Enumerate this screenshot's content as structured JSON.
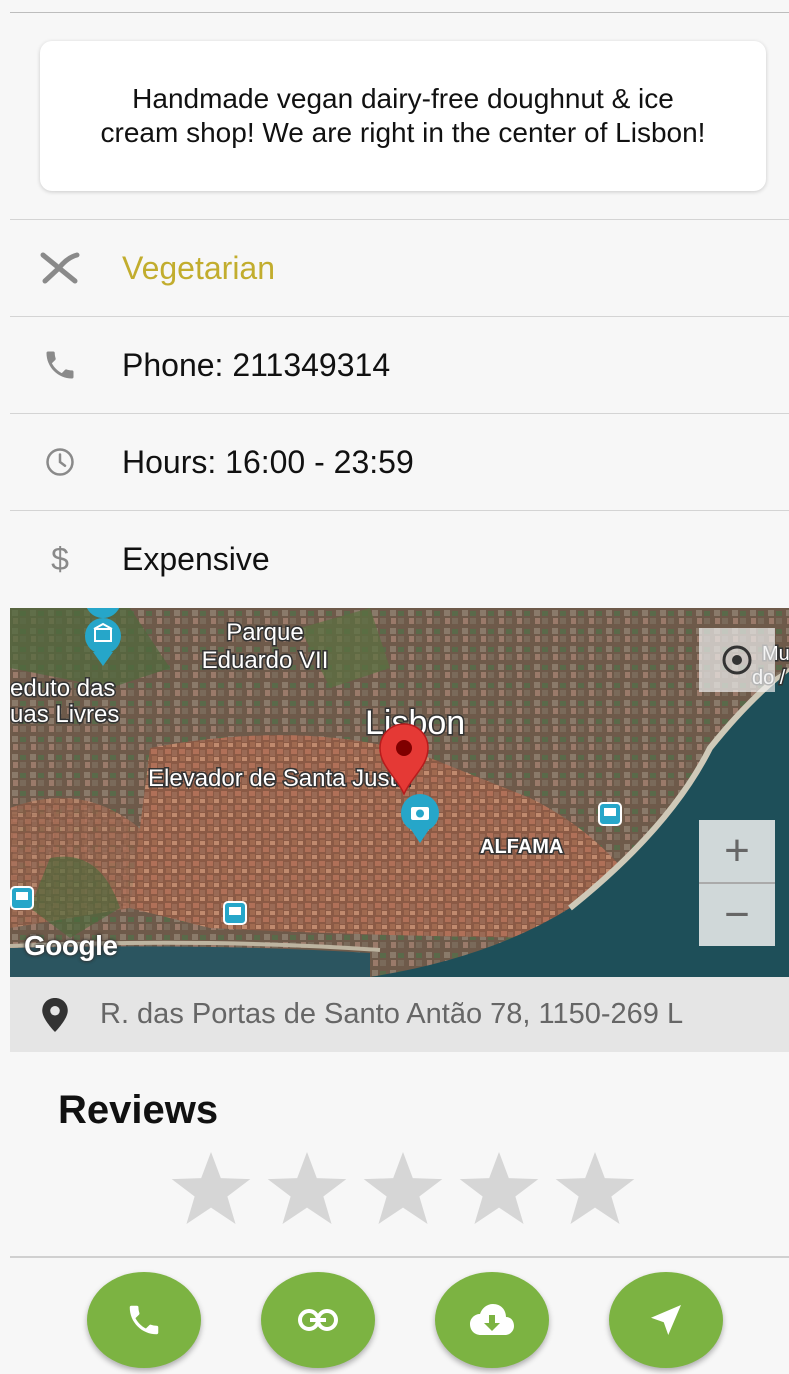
{
  "description": "Handmade vegan dairy-free doughnut & ice cream shop! We are right in the center of Lisbon!",
  "details": {
    "category": "Vegetarian",
    "phone": "Phone: 211349314",
    "hours": "Hours: 16:00 - 23:59",
    "price": "Expensive",
    "price_icon": "$"
  },
  "map": {
    "labels": {
      "park_line1": "Parque",
      "park_line2": "Eduardo VII",
      "aqueduct_line1": "eduto das",
      "aqueduct_line2": "uas Livres",
      "city": "Lisbon",
      "elevator": "Elevador de Santa Justa",
      "district": "ALFAMA",
      "museum_line1": "Mu",
      "museum_line2": "do /"
    },
    "zoom_in": "+",
    "zoom_out": "−",
    "attribution": "Google",
    "marker_color": "#e53935",
    "poi_color": "#26a6c9"
  },
  "address": "R. das Portas de Santo Antão 78, 1150-269 L",
  "reviews": {
    "title": "Reviews",
    "rating": 0,
    "max_rating": 5
  },
  "actions": {
    "color": "#7cb342",
    "buttons": [
      "phone-icon",
      "link-icon",
      "cloud-download-icon",
      "navigation-icon"
    ]
  }
}
